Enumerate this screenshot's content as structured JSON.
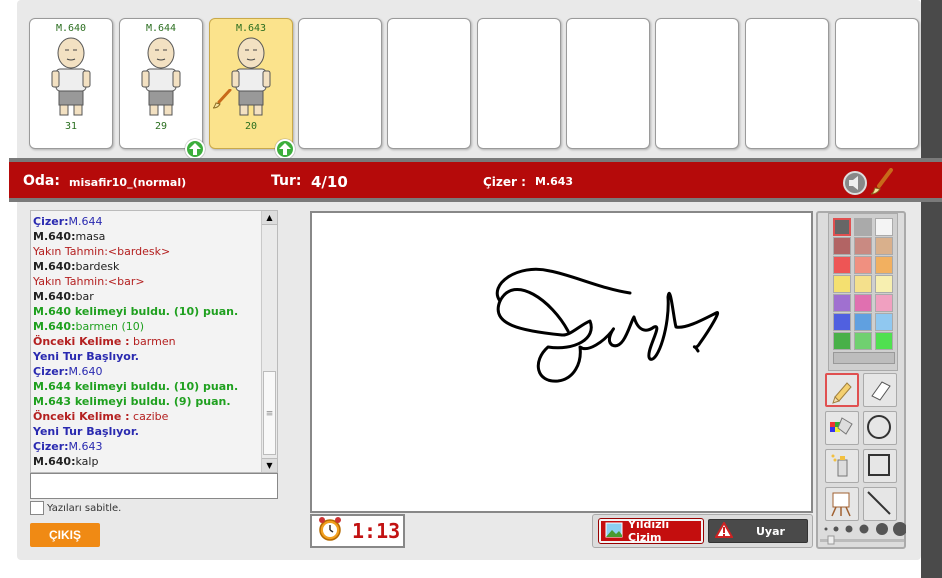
{
  "players": [
    {
      "name": "M.640",
      "score": "31",
      "active": false,
      "up_badge": false,
      "drawing": false
    },
    {
      "name": "M.644",
      "score": "29",
      "active": false,
      "up_badge": true,
      "drawing": false
    },
    {
      "name": "M.643",
      "score": "20",
      "active": true,
      "up_badge": true,
      "drawing": true
    }
  ],
  "status_bar": {
    "room_label": "Oda:",
    "room_name": "misafir10_(normal)",
    "round_label": "Tur:",
    "round_value": "4/10",
    "drawer_label": "Çizer :",
    "drawer_value": "M.643"
  },
  "chat": {
    "messages": [
      {
        "prefix": "Çizer:",
        "text": "M.644",
        "style": "drawer"
      },
      {
        "prefix": "M.640:",
        "text": "masa",
        "style": "guess"
      },
      {
        "prefix": "",
        "text": "Yakın Tahmin:<bardesk>",
        "style": "close"
      },
      {
        "prefix": "M.640:",
        "text": "bardesk",
        "style": "guess"
      },
      {
        "prefix": "",
        "text": "Yakın Tahmin:<bar>",
        "style": "close"
      },
      {
        "prefix": "M.640:",
        "text": "bar",
        "style": "guess"
      },
      {
        "prefix": "",
        "text": "M.640 kelimeyi buldu. (10) puan.",
        "style": "found"
      },
      {
        "prefix": "M.640:",
        "text": "barmen (10)",
        "style": "correct"
      },
      {
        "prefix": "Önceki Kelime :",
        "text": " barmen",
        "style": "prev"
      },
      {
        "prefix": "",
        "text": "Yeni Tur Başlıyor.",
        "style": "newround"
      },
      {
        "prefix": "Çizer:",
        "text": "M.640",
        "style": "drawer"
      },
      {
        "prefix": "",
        "text": "M.644 kelimeyi buldu. (10) puan.",
        "style": "found"
      },
      {
        "prefix": "",
        "text": "M.643 kelimeyi buldu. (9) puan.",
        "style": "found"
      },
      {
        "prefix": "Önceki Kelime :",
        "text": " cazibe",
        "style": "prev"
      },
      {
        "prefix": "",
        "text": "Yeni Tur Başlıyor.",
        "style": "newround"
      },
      {
        "prefix": "Çizer:",
        "text": "M.643",
        "style": "drawer"
      },
      {
        "prefix": "M.640:",
        "text": "kalp",
        "style": "guess"
      }
    ],
    "input_value": "",
    "pin_label": "Yazıları sabitle.",
    "exit_label": "ÇIKIŞ"
  },
  "timer": "1:13",
  "actions": {
    "starred_label": "Yıldızlı Çizim",
    "warn_label": "Uyar"
  },
  "palette": [
    "#666666",
    "#aaaaaa",
    "#f4f4f4",
    "#b26464",
    "#c98a82",
    "#d9b08c",
    "#ee5555",
    "#f09080",
    "#f2b060",
    "#f4e070",
    "#f4e08c",
    "#f7efb0",
    "#a070d0",
    "#e070b0",
    "#f0a0c0",
    "#5060e0",
    "#60a0e0",
    "#90c8f0",
    "#48b048",
    "#70d070",
    "#50e050"
  ],
  "colors": {
    "accent_red": "#b50a0a",
    "exit_orange": "#f08a14",
    "active_slot": "#fbe38c"
  }
}
